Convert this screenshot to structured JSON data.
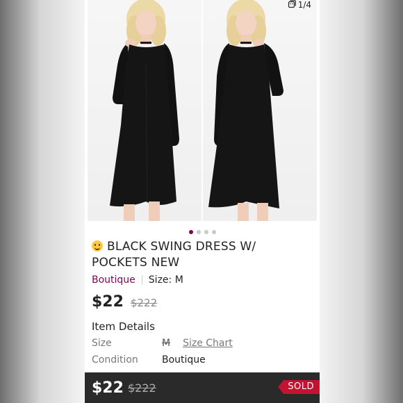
{
  "gallery": {
    "counter": "1/4",
    "counter_icon": "image-stack-icon",
    "total_images": 4,
    "active_index": 0
  },
  "listing": {
    "title": "BLACK SWING DRESS W/ POCKETS NEW",
    "title_emoji": "smiling-face-emoji",
    "brand": "Boutique",
    "size_label": "Size: M",
    "price": "$22",
    "original_price": "$222"
  },
  "details": {
    "heading": "Item Details",
    "rows": [
      {
        "key": "Size",
        "value": "M",
        "link": "Size Chart"
      },
      {
        "key": "Condition",
        "value": "Boutique"
      }
    ]
  },
  "bottom_bar": {
    "price": "$22",
    "original_price": "$222",
    "status": "SOLD"
  },
  "colors": {
    "brand_accent": "#7f0353",
    "sold_badge": "#c31331",
    "bottom_bar": "#2a2a2a"
  }
}
